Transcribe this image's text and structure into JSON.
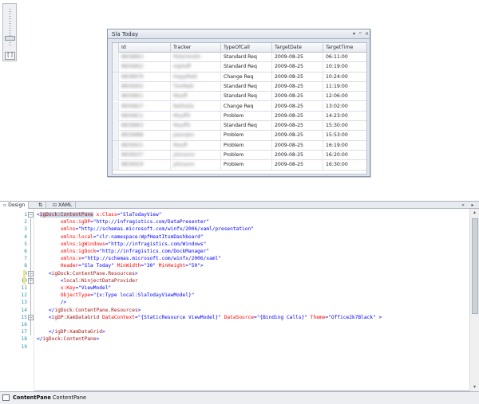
{
  "design_surface": {
    "zoom_fit_label": "[ ]",
    "pane": {
      "title": "Sla Today",
      "buttons": [
        "▾",
        "ᵖ",
        "×"
      ],
      "grid": {
        "columns": [
          "Id",
          "Tracker",
          "TypeOfCall",
          "TargetDate",
          "TargetTime"
        ],
        "rows": [
          {
            "id": "8838863",
            "tracker": "PeterSmith",
            "type": "Standard Req",
            "date": "2009-08-25",
            "time": "06:11:00"
          },
          {
            "id": "8836852",
            "tracker": "mphoff",
            "type": "Standard Req",
            "date": "2009-08-25",
            "time": "10:19:00"
          },
          {
            "id": "8838879",
            "tracker": "HopyMatt",
            "type": "Change Req",
            "date": "2009-08-25",
            "time": "10:24:00"
          },
          {
            "id": "8836902",
            "tracker": "TimMatt",
            "type": "Standard Req",
            "date": "2009-08-25",
            "time": "11:19:00"
          },
          {
            "id": "8836851",
            "tracker": "Mauff",
            "type": "Standard Req",
            "date": "2009-08-25",
            "time": "12:06:00"
          },
          {
            "id": "8836827",
            "tracker": "Nathalia",
            "type": "Change Req",
            "date": "2009-08-25",
            "time": "13:02:00"
          },
          {
            "id": "8836811",
            "tracker": "MauffS",
            "type": "Problem",
            "date": "2009-08-25",
            "time": "14:23:00"
          },
          {
            "id": "8838863",
            "tracker": "MauffS",
            "type": "Standard Req",
            "date": "2009-08-25",
            "time": "15:30:00"
          },
          {
            "id": "8836888",
            "tracker": "JasonJen",
            "type": "Problem",
            "date": "2009-08-25",
            "time": "15:53:00"
          },
          {
            "id": "8836921",
            "tracker": "Mauff",
            "type": "Problem",
            "date": "2009-08-25",
            "time": "16:19:00"
          },
          {
            "id": "8836937",
            "tracker": "johnavm",
            "type": "Problem",
            "date": "2009-08-25",
            "time": "16:20:00"
          },
          {
            "id": "8836929",
            "tracker": "johnavm",
            "type": "Problem",
            "date": "2009-08-25",
            "time": "16:30:00"
          }
        ]
      }
    }
  },
  "tabs": {
    "design": "Design",
    "swap": "⇅",
    "xaml": "XAML",
    "collapse": "«",
    "more": "▸"
  },
  "editor": {
    "lines": [
      [
        {
          "t": "<",
          "c": "pu"
        },
        {
          "t": "igDock:ContentPane",
          "c": "el",
          "hl": true
        },
        {
          "t": " x:Class",
          "c": "at"
        },
        {
          "t": "=\"SlaTodayView\"",
          "c": "va"
        }
      ],
      [
        {
          "t": "        xmlns:igDP",
          "c": "at"
        },
        {
          "t": "=\"http://infragistics.com/DataPresenter\"",
          "c": "va"
        }
      ],
      [
        {
          "t": "        xmlns",
          "c": "at"
        },
        {
          "t": "=\"http://schemas.microsoft.com/winfx/2006/xaml/presentation\"",
          "c": "va"
        }
      ],
      [
        {
          "t": "        xmlns:local",
          "c": "at"
        },
        {
          "t": "=\"clr-namespace:WpfHeatItsmDashboard\"",
          "c": "va"
        }
      ],
      [
        {
          "t": "        xmlns:igWindows",
          "c": "at"
        },
        {
          "t": "=\"http://infragistics.com/Windows\"",
          "c": "va"
        }
      ],
      [
        {
          "t": "        xmlns:igDock",
          "c": "at"
        },
        {
          "t": "=\"http://infragistics.com/DockManager\"",
          "c": "va"
        }
      ],
      [
        {
          "t": "        xmlns:x",
          "c": "at"
        },
        {
          "t": "=\"http://schemas.microsoft.com/winfx/2006/xaml\"",
          "c": "va"
        }
      ],
      [
        {
          "t": "        Header",
          "c": "at"
        },
        {
          "t": "=\"Sla Today\"",
          "c": "va"
        },
        {
          "t": " MinWidth",
          "c": "at"
        },
        {
          "t": "=\"30\"",
          "c": "va"
        },
        {
          "t": " MinHeight",
          "c": "at"
        },
        {
          "t": "=\"50\"",
          "c": "va"
        },
        {
          "t": ">",
          "c": "pu"
        }
      ],
      [
        {
          "t": "    <",
          "c": "pu"
        },
        {
          "t": "igDock:ContentPane.Resources",
          "c": "el"
        },
        {
          "t": ">",
          "c": "pu"
        }
      ],
      [
        {
          "t": "        <",
          "c": "pu"
        },
        {
          "t": "local:NinjectDataProvider",
          "c": "el"
        }
      ],
      [
        {
          "t": "        x:Key",
          "c": "at"
        },
        {
          "t": "=\"ViewModel\"",
          "c": "va"
        }
      ],
      [
        {
          "t": "        ObjectType",
          "c": "at"
        },
        {
          "t": "=\"{x:Type local:SlaTodayViewModel}\"",
          "c": "va"
        }
      ],
      [
        {
          "t": "        />",
          "c": "pu"
        }
      ],
      [
        {
          "t": "    </",
          "c": "pu"
        },
        {
          "t": "igDock:ContentPane.Resources",
          "c": "el"
        },
        {
          "t": ">",
          "c": "pu"
        }
      ],
      [
        {
          "t": "    <",
          "c": "pu"
        },
        {
          "t": "igDP:XamDataGrid",
          "c": "el"
        },
        {
          "t": " DataContext",
          "c": "at"
        },
        {
          "t": "=\"{StaticResource ViewModel}\"",
          "c": "va"
        },
        {
          "t": " DataSource",
          "c": "at"
        },
        {
          "t": "=\"{Binding Calls}\"",
          "c": "va"
        },
        {
          "t": " Theme",
          "c": "at"
        },
        {
          "t": "=\"Office2k7Black\"",
          "c": "va"
        },
        {
          "t": " >",
          "c": "pu"
        }
      ],
      [
        {
          "t": "",
          "c": "pu"
        }
      ],
      [
        {
          "t": "    </",
          "c": "pu"
        },
        {
          "t": "igDP:XamDataGrid",
          "c": "el"
        },
        {
          "t": ">",
          "c": "pu"
        }
      ],
      [
        {
          "t": "</",
          "c": "pu"
        },
        {
          "t": "igDock:ContentPane",
          "c": "el"
        },
        {
          "t": ">",
          "c": "pu"
        }
      ],
      [
        {
          "t": "",
          "c": "pu"
        }
      ]
    ]
  },
  "status_bar": {
    "breadcrumb_bold": "ContentPane",
    "breadcrumb_rest": " ContentPane"
  }
}
